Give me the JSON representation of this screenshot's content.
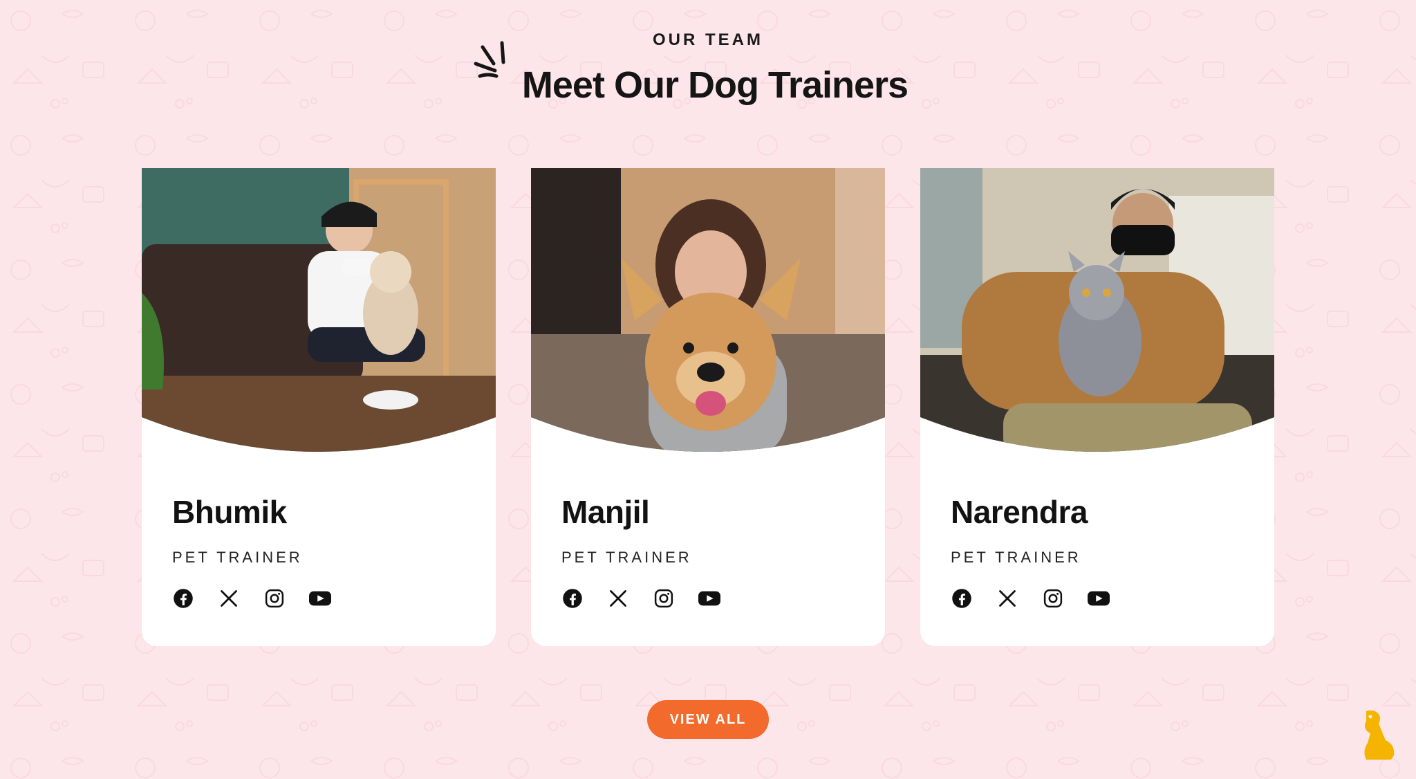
{
  "section": {
    "eyebrow": "OUR TEAM",
    "title": "Meet Our Dog Trainers"
  },
  "trainers": [
    {
      "name": "Bhumik",
      "role": "PET TRAINER"
    },
    {
      "name": "Manjil",
      "role": "PET TRAINER"
    },
    {
      "name": "Narendra",
      "role": "PET TRAINER"
    }
  ],
  "socials": [
    "facebook-icon",
    "x-icon",
    "instagram-icon",
    "youtube-icon"
  ],
  "cta": {
    "label": "VIEW ALL"
  },
  "colors": {
    "background": "#fde6ea",
    "accent": "#f26a2c",
    "mascot": "#f5b400",
    "card": "#ffffff"
  }
}
